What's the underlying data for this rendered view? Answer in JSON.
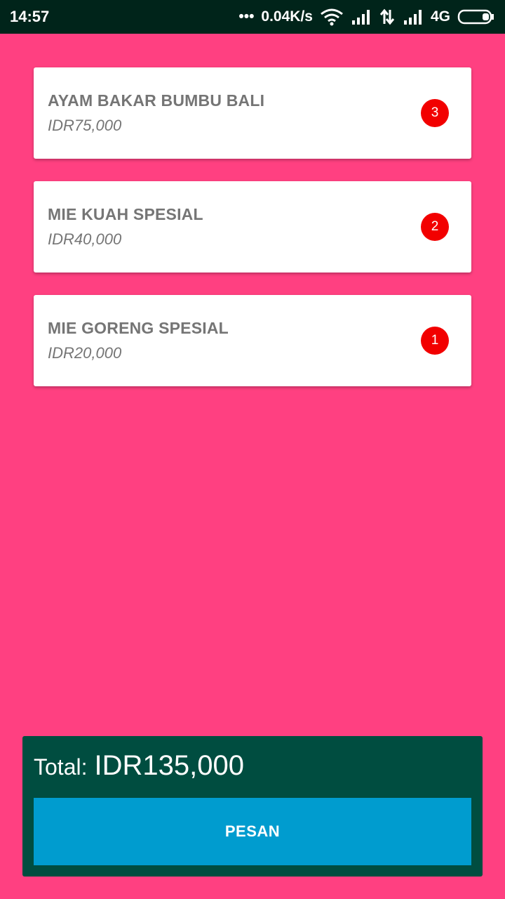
{
  "status_bar": {
    "time": "14:57",
    "dots": "•••",
    "speed": "0.04K/s",
    "network": "4G",
    "icons": [
      "wifi-icon",
      "signal-bars-icon",
      "data-transfer-icon",
      "signal-bars-icon",
      "battery-icon"
    ]
  },
  "colors": {
    "background": "#FF4081",
    "status_bar": "#00241A",
    "footer": "#004D40",
    "button": "#009CCF",
    "badge": "#F20000",
    "card": "#FFFFFF",
    "card_text": "#757575"
  },
  "cart": {
    "items": [
      {
        "name": "AYAM BAKAR BUMBU BALI",
        "price": "IDR75,000",
        "qty": "3"
      },
      {
        "name": "MIE KUAH SPESIAL",
        "price": "IDR40,000",
        "qty": "2"
      },
      {
        "name": "MIE GORENG SPESIAL",
        "price": "IDR20,000",
        "qty": "1"
      }
    ]
  },
  "footer": {
    "total_label": "Total:",
    "total_value": "IDR135,000",
    "order_button_label": "PESAN"
  }
}
